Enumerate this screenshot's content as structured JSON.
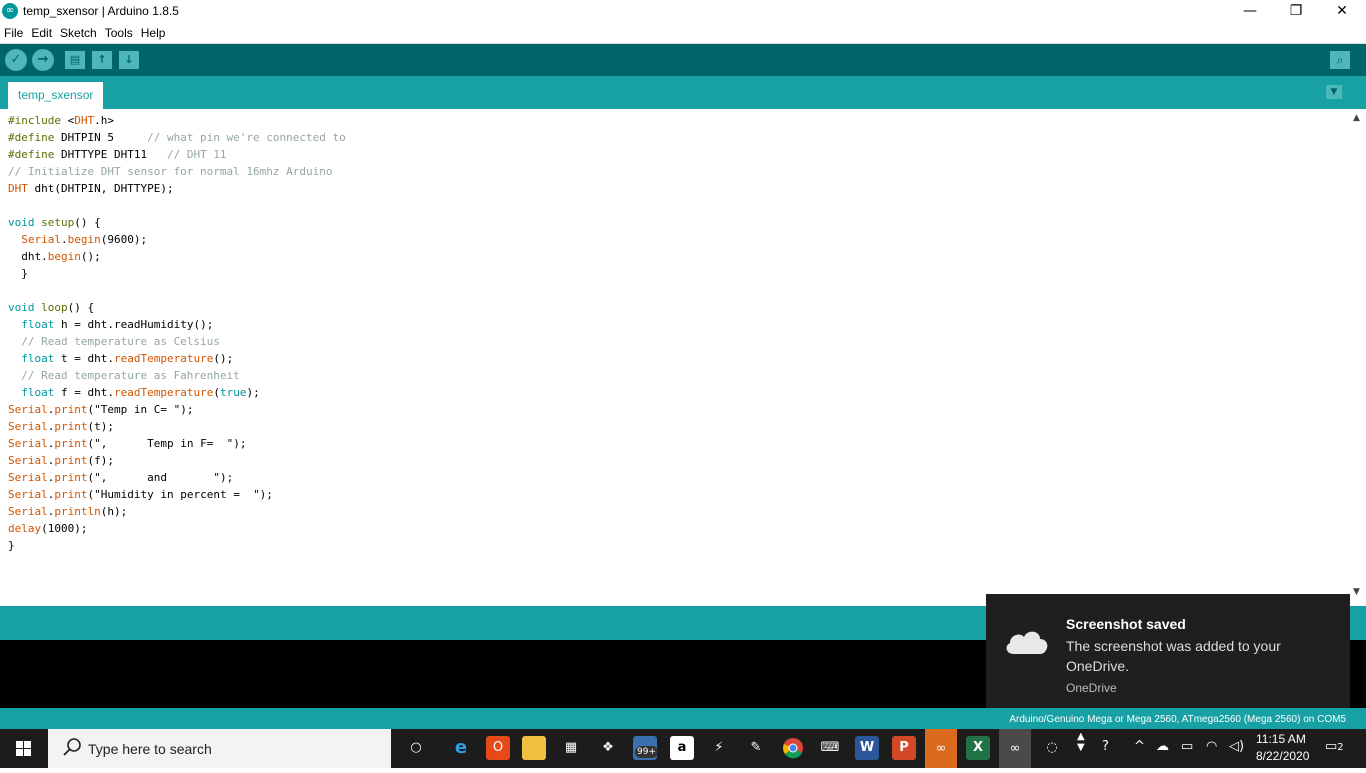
{
  "window": {
    "title": "temp_sxensor | Arduino 1.8.5"
  },
  "menu": {
    "items": [
      "File",
      "Edit",
      "Sketch",
      "Tools",
      "Help"
    ]
  },
  "tabs": [
    {
      "label": "temp_sxensor"
    }
  ],
  "code_lines": [
    [
      {
        "t": "#include ",
        "c": "#5e6d03"
      },
      {
        "t": "<",
        "c": "#000"
      },
      {
        "t": "DHT",
        "c": "#d35400"
      },
      {
        "t": ".h>",
        "c": "#000"
      }
    ],
    [
      {
        "t": "#define ",
        "c": "#5e6d03"
      },
      {
        "t": "DHTPIN 5     ",
        "c": "#000"
      },
      {
        "t": "// what pin we're connected to",
        "c": "#95a5a6"
      }
    ],
    [
      {
        "t": "#define ",
        "c": "#5e6d03"
      },
      {
        "t": "DHTTYPE DHT11   ",
        "c": "#000"
      },
      {
        "t": "// DHT 11",
        "c": "#95a5a6"
      }
    ],
    [
      {
        "t": "// Initialize DHT sensor for normal 16mhz Arduino",
        "c": "#95a5a6"
      }
    ],
    [
      {
        "t": "DHT ",
        "c": "#d35400"
      },
      {
        "t": "dht(DHTPIN, DHTTYPE);",
        "c": "#000"
      }
    ],
    [],
    [
      {
        "t": "void ",
        "c": "#00979c"
      },
      {
        "t": "setup",
        "c": "#5e6d03"
      },
      {
        "t": "() {",
        "c": "#000"
      }
    ],
    [
      {
        "t": "  ",
        "c": "#000"
      },
      {
        "t": "Serial",
        "c": "#d35400"
      },
      {
        "t": ".",
        "c": "#000"
      },
      {
        "t": "begin",
        "c": "#d35400"
      },
      {
        "t": "(9600);",
        "c": "#000"
      }
    ],
    [
      {
        "t": "  dht.",
        "c": "#000"
      },
      {
        "t": "begin",
        "c": "#d35400"
      },
      {
        "t": "();",
        "c": "#000"
      }
    ],
    [
      {
        "t": "  }",
        "c": "#000"
      }
    ],
    [],
    [
      {
        "t": "void ",
        "c": "#00979c"
      },
      {
        "t": "loop",
        "c": "#5e6d03"
      },
      {
        "t": "() {",
        "c": "#000"
      }
    ],
    [
      {
        "t": "  ",
        "c": "#000"
      },
      {
        "t": "float ",
        "c": "#00979c"
      },
      {
        "t": "h = dht.readHumidity();",
        "c": "#000"
      }
    ],
    [
      {
        "t": "  // Read temperature as Celsius",
        "c": "#95a5a6"
      }
    ],
    [
      {
        "t": "  ",
        "c": "#000"
      },
      {
        "t": "float ",
        "c": "#00979c"
      },
      {
        "t": "t = dht.",
        "c": "#000"
      },
      {
        "t": "readTemperature",
        "c": "#d35400"
      },
      {
        "t": "();",
        "c": "#000"
      }
    ],
    [
      {
        "t": "  // Read temperature as Fahrenheit",
        "c": "#95a5a6"
      }
    ],
    [
      {
        "t": "  ",
        "c": "#000"
      },
      {
        "t": "float ",
        "c": "#00979c"
      },
      {
        "t": "f = dht.",
        "c": "#000"
      },
      {
        "t": "readTemperature",
        "c": "#d35400"
      },
      {
        "t": "(",
        "c": "#000"
      },
      {
        "t": "true",
        "c": "#00979c"
      },
      {
        "t": ");",
        "c": "#000"
      }
    ],
    [
      {
        "t": "Serial",
        "c": "#d35400"
      },
      {
        "t": ".",
        "c": "#000"
      },
      {
        "t": "print",
        "c": "#d35400"
      },
      {
        "t": "(\"Temp in C= \");",
        "c": "#000"
      }
    ],
    [
      {
        "t": "Serial",
        "c": "#d35400"
      },
      {
        "t": ".",
        "c": "#000"
      },
      {
        "t": "print",
        "c": "#d35400"
      },
      {
        "t": "(t);",
        "c": "#000"
      }
    ],
    [
      {
        "t": "Serial",
        "c": "#d35400"
      },
      {
        "t": ".",
        "c": "#000"
      },
      {
        "t": "print",
        "c": "#d35400"
      },
      {
        "t": "(\",      Temp in F=  \");",
        "c": "#000"
      }
    ],
    [
      {
        "t": "Serial",
        "c": "#d35400"
      },
      {
        "t": ".",
        "c": "#000"
      },
      {
        "t": "print",
        "c": "#d35400"
      },
      {
        "t": "(f);",
        "c": "#000"
      }
    ],
    [
      {
        "t": "Serial",
        "c": "#d35400"
      },
      {
        "t": ".",
        "c": "#000"
      },
      {
        "t": "print",
        "c": "#d35400"
      },
      {
        "t": "(\",      and       \");",
        "c": "#000"
      }
    ],
    [
      {
        "t": "Serial",
        "c": "#d35400"
      },
      {
        "t": ".",
        "c": "#000"
      },
      {
        "t": "print",
        "c": "#d35400"
      },
      {
        "t": "(\"Humidity in percent =  \");",
        "c": "#000"
      }
    ],
    [
      {
        "t": "Serial",
        "c": "#d35400"
      },
      {
        "t": ".",
        "c": "#000"
      },
      {
        "t": "println",
        "c": "#d35400"
      },
      {
        "t": "(h);",
        "c": "#000"
      }
    ],
    [
      {
        "t": "delay",
        "c": "#d35400"
      },
      {
        "t": "(1000);",
        "c": "#000"
      }
    ],
    [
      {
        "t": "}",
        "c": "#000"
      }
    ]
  ],
  "status": {
    "board": "Arduino/Genuino Mega or Mega 2560, ATmega2560 (Mega 2560) on COM5"
  },
  "toast": {
    "title": "Screenshot saved",
    "body": "The screenshot was added to your OneDrive.",
    "source": "OneDrive"
  },
  "taskbar": {
    "search_placeholder": "Type here to search",
    "badge": "99+",
    "time": "11:15 AM",
    "date": "8/22/2020",
    "notifications": "2"
  },
  "colors": {
    "toolbar": "#006468",
    "tabbar": "#17a1a5",
    "button": "#4db7bb"
  }
}
